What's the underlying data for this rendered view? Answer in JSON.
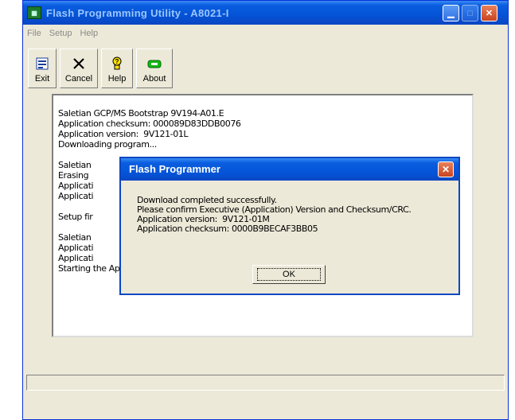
{
  "window": {
    "title": "Flash Programming Utility - A8021-I",
    "app_icon": "chip-icon",
    "controls": [
      "minimize-icon",
      "maximize-icon",
      "close-icon"
    ]
  },
  "menu": {
    "items": [
      "File",
      "Setup",
      "Help"
    ]
  },
  "toolbar": {
    "buttons": [
      {
        "label": "Exit",
        "icon": "exit-icon"
      },
      {
        "label": "Cancel",
        "icon": "cancel-x-icon"
      },
      {
        "label": "Help",
        "icon": "help-bulb-icon"
      },
      {
        "label": "About",
        "icon": "about-icon"
      }
    ]
  },
  "log": {
    "text": "Saletian GCP/MS Bootstrap 9V194-A01.E\nApplication checksum: 000089D83DDB0076\nApplication version:  9V121-01L\nDownloading program...\n\nSaletian\nErasing \nApplicati\nApplicati\n\nSetup fir\n\nSaletian\nApplicati\nApplicati\nStarting the Application"
  },
  "dialog": {
    "title": "Flash Programmer",
    "lines": [
      "Download completed successfully.",
      "Please confirm Executive (Application) Version and Checksum/CRC.",
      "Application version:  9V121-01M",
      "Application checksum: 0000B9BECAF3BB05"
    ],
    "ok_label": "OK"
  },
  "colors": {
    "titlebar": "#0453d6",
    "window_bg": "#ece9d8",
    "close_button": "#c8441f"
  }
}
